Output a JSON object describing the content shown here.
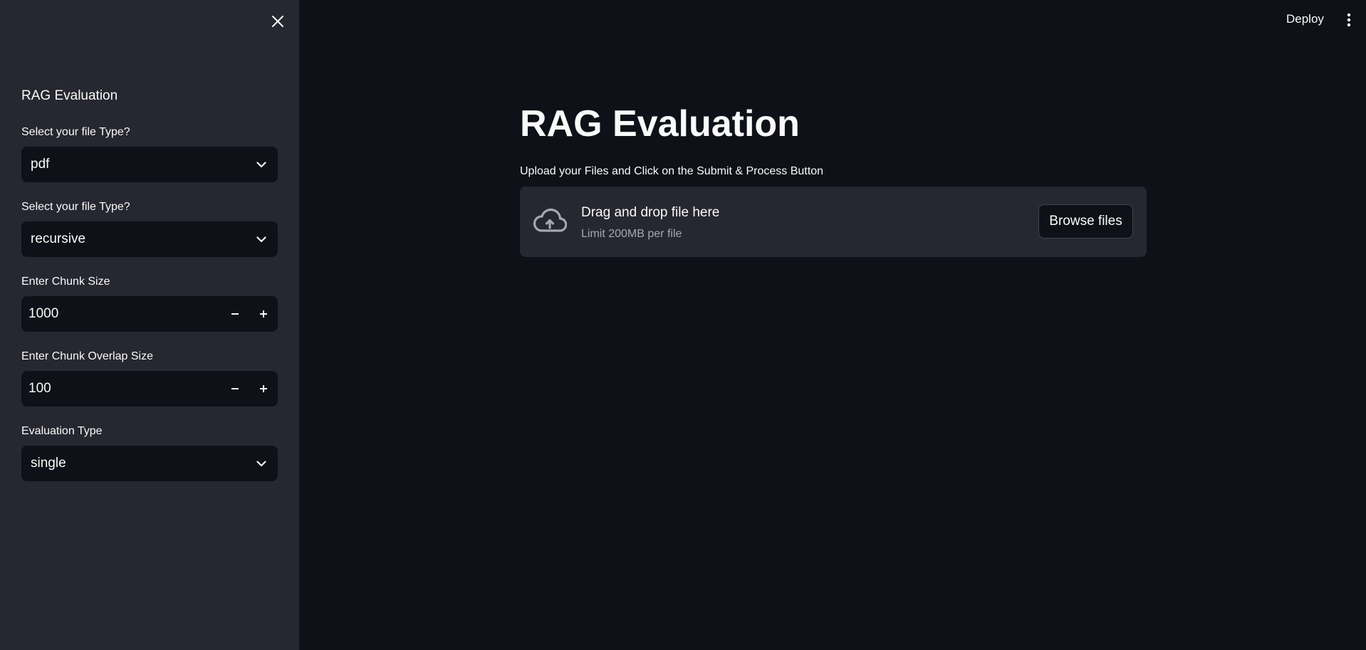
{
  "header": {
    "deploy_label": "Deploy",
    "menu_icon": "kebab-menu-icon"
  },
  "sidebar": {
    "close_icon": "close-icon",
    "title": "RAG Evaluation",
    "file_type": {
      "label": "Select your file Type?",
      "value": "pdf"
    },
    "splitter_type": {
      "label": "Select your file Type?",
      "value": "recursive"
    },
    "chunk_size": {
      "label": "Enter Chunk Size",
      "value": "1000",
      "decrement": "−",
      "increment": "+"
    },
    "chunk_overlap": {
      "label": "Enter Chunk Overlap Size",
      "value": "100",
      "decrement": "−",
      "increment": "+"
    },
    "evaluation_type": {
      "label": "Evaluation Type",
      "value": "single"
    }
  },
  "main": {
    "title": "RAG Evaluation",
    "upload_label": "Upload your Files and Click on the Submit & Process Button",
    "dropzone": {
      "icon": "cloud-upload-icon",
      "primary": "Drag and drop file here",
      "secondary": "Limit 200MB per file",
      "button": "Browse files"
    }
  },
  "colors": {
    "background": "#0e1117",
    "sidebar": "#262730",
    "text": "#fafafa",
    "muted_text": "#a3a8b4"
  }
}
